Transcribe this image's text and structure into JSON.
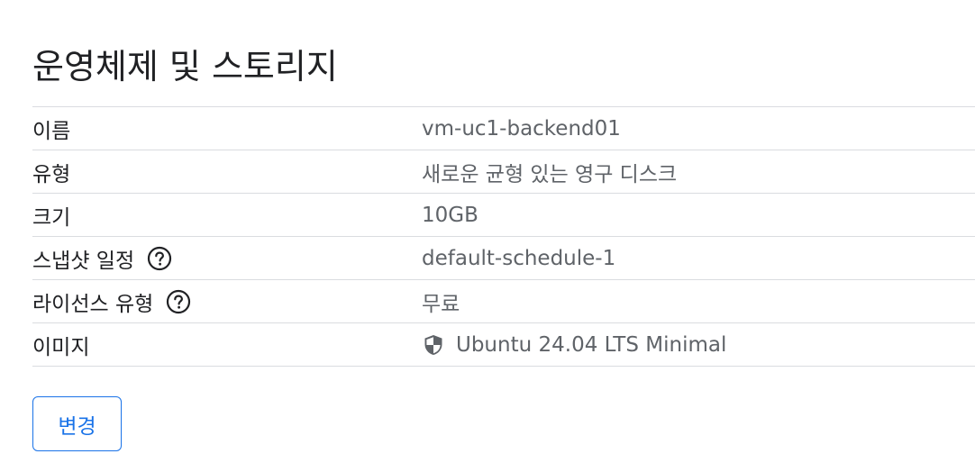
{
  "section": {
    "title": "운영체제 및 스토리지"
  },
  "rows": [
    {
      "label": "이름",
      "value": "vm-uc1-backend01"
    },
    {
      "label": "유형",
      "value": "새로운 균형 있는 영구 디스크"
    },
    {
      "label": "크기",
      "value": "10GB"
    },
    {
      "label": "스냅샷 일정",
      "value": "default-schedule-1",
      "icon": "help-circle-icon"
    },
    {
      "label": "라이선스 유형",
      "value": "무료",
      "icon": "help-circle-icon"
    },
    {
      "label": "이미지",
      "value": "Ubuntu 24.04 LTS Minimal",
      "value_icon": "shield-icon"
    }
  ],
  "actions": {
    "change_label": "변경"
  },
  "colors": {
    "accent": "#1a73e8",
    "divider": "#dadce0",
    "label_text": "#202124",
    "value_text": "#5f6368"
  }
}
